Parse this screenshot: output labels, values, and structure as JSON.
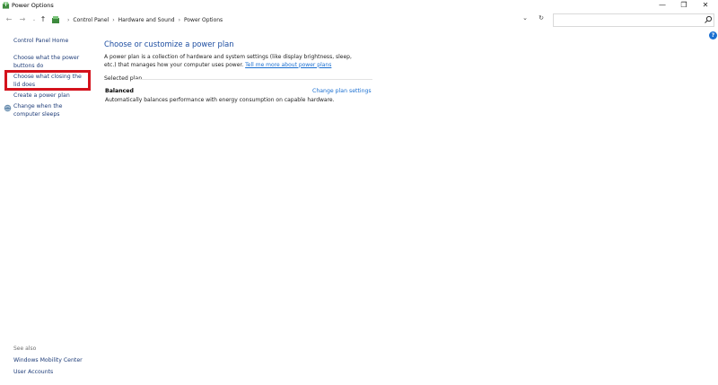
{
  "window": {
    "title": "Power Options",
    "minimize": "—",
    "maximize": "❐",
    "close": "✕"
  },
  "nav": {
    "back": "←",
    "forward": "→",
    "recent": "⌄",
    "up": "↑",
    "dropdown": "⌄",
    "refresh": "↻",
    "breadcrumbs": [
      "Control Panel",
      "Hardware and Sound",
      "Power Options"
    ],
    "separator": "›",
    "search_placeholder": ""
  },
  "help": "?",
  "sidebar": {
    "home": "Control Panel Home",
    "items": [
      "Choose what the power buttons do",
      "Choose what closing the lid does",
      "Create a power plan",
      "Change when the computer sleeps"
    ],
    "see_also_label": "See also",
    "see_also": [
      "Windows Mobility Center",
      "User Accounts"
    ]
  },
  "main": {
    "heading": "Choose or customize a power plan",
    "description": "A power plan is a collection of hardware and system settings (like display brightness, sleep, etc.) that manages how your computer uses power.",
    "description_link": "Tell me more about power plans",
    "selected_plan_label": "Selected plan",
    "plan_name": "Balanced",
    "change_plan_label": "Change plan settings",
    "plan_description": "Automatically balances performance with energy consumption on capable hardware."
  },
  "colors": {
    "link": "#1a6fd1",
    "heading": "#1e4ea1",
    "highlight": "#d4121c"
  }
}
